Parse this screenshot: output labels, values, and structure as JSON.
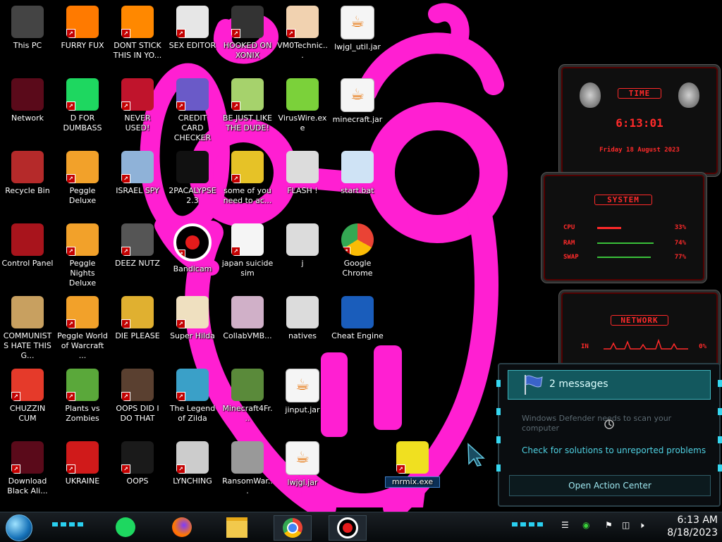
{
  "desktop": {
    "icons": [
      {
        "label": "This PC",
        "icon": "computer-icon",
        "shortcut": false
      },
      {
        "label": "FURRY FUX",
        "icon": "firefox-icon",
        "shortcut": true
      },
      {
        "label": "DONT STICK THIS IN YO...",
        "icon": "vlc-cone-icon",
        "shortcut": true
      },
      {
        "label": "SEX EDITOR",
        "icon": "hex-editor-icon",
        "shortcut": true
      },
      {
        "label": "HOOKED ON XONIX",
        "icon": "xonix-game-icon",
        "shortcut": true
      },
      {
        "label": "VM0Technic...",
        "icon": "doctor-avatar-icon",
        "shortcut": true
      },
      {
        "label": "lwjgl_util.jar",
        "icon": "java-icon",
        "shortcut": false
      },
      {
        "label": "Network",
        "icon": "alienware-network-icon",
        "shortcut": false
      },
      {
        "label": "D FOR DUMBASS",
        "icon": "green-app-icon",
        "shortcut": true
      },
      {
        "label": "NEVER USED!",
        "icon": "devcpp-icon",
        "shortcut": true
      },
      {
        "label": "CREDIT CARD CHECKER",
        "icon": "credit-card-icon",
        "shortcut": true
      },
      {
        "label": "BE JUST LIKE THE DUDE!",
        "icon": "santa-icon",
        "shortcut": true
      },
      {
        "label": "VirusWire.exe",
        "icon": "lime-icon",
        "shortcut": false
      },
      {
        "label": "minecraft.jar",
        "icon": "java-icon",
        "shortcut": false
      },
      {
        "label": "Recycle Bin",
        "icon": "recycle-bin-icon",
        "shortcut": false
      },
      {
        "label": "Peggle Deluxe",
        "icon": "peggle-icon",
        "shortcut": true
      },
      {
        "label": "ISRAEL SPY",
        "icon": "network-spy-icon",
        "shortcut": true
      },
      {
        "label": "2PACALYPSE 2.3",
        "icon": "terminal-icon",
        "shortcut": false
      },
      {
        "label": "some of you need to ac...",
        "icon": "dog-icon",
        "shortcut": true
      },
      {
        "label": "FLASH !",
        "icon": "flash-file-icon",
        "shortcut": false
      },
      {
        "label": "start.bat",
        "icon": "batch-file-icon",
        "shortcut": false
      },
      {
        "label": "Control Panel",
        "icon": "control-panel-icon",
        "shortcut": false
      },
      {
        "label": "Peggle Nights Deluxe",
        "icon": "peggle-icon",
        "shortcut": true
      },
      {
        "label": "DEEZ NUTZ",
        "icon": "windows-stack-icon",
        "shortcut": true
      },
      {
        "label": "Bandicam",
        "icon": "record-icon",
        "shortcut": true
      },
      {
        "label": "japan suicide sim",
        "icon": "document-icon",
        "shortcut": true
      },
      {
        "label": "j",
        "icon": "file-icon",
        "shortcut": false
      },
      {
        "label": "Google Chrome",
        "icon": "chrome-icon",
        "shortcut": true
      },
      {
        "label": "COMMUNISTS HATE THIS G...",
        "icon": "money-bag-icon",
        "shortcut": false
      },
      {
        "label": "Peggle World of Warcraft ...",
        "icon": "peggle-icon",
        "shortcut": true
      },
      {
        "label": "DIE PLEASE",
        "icon": "de-icon",
        "shortcut": true
      },
      {
        "label": "Super Hilda",
        "icon": "pixel-art-icon",
        "shortcut": true
      },
      {
        "label": "CollabVMB...",
        "icon": "collabvm-icon",
        "shortcut": false
      },
      {
        "label": "natives",
        "icon": "file-icon",
        "shortcut": false
      },
      {
        "label": "Cheat Engine",
        "icon": "cheat-engine-icon",
        "shortcut": false
      },
      {
        "label": "CHUZZIN CUM",
        "icon": "chuzzle-icon",
        "shortcut": true
      },
      {
        "label": "Plants vs Zombies",
        "icon": "plants-icon",
        "shortcut": true
      },
      {
        "label": "OOPS DID I DO THAT",
        "icon": "portrait-icon",
        "shortcut": true
      },
      {
        "label": "The Legend of Zilda",
        "icon": "zelda-icon",
        "shortcut": true
      },
      {
        "label": "Minecraft4Fr...",
        "icon": "minecraft-icon",
        "shortcut": false
      },
      {
        "label": "jinput.jar",
        "icon": "java-icon",
        "shortcut": false
      },
      {
        "label": "Download Black Ali...",
        "icon": "alienware-icon",
        "shortcut": true
      },
      {
        "label": "UKRAINE",
        "icon": "radiation-icon",
        "shortcut": true
      },
      {
        "label": "OOPS",
        "icon": "skull-monitor-icon",
        "shortcut": true
      },
      {
        "label": "LYNCHING",
        "icon": "noose-icon",
        "shortcut": true
      },
      {
        "label": "RansomWar...",
        "icon": "skull-icon",
        "shortcut": false
      },
      {
        "label": "lwjgl.jar",
        "icon": "java-icon",
        "shortcut": false
      },
      {
        "label": "mrmix.exe",
        "icon": "yellow-face-icon",
        "shortcut": true
      }
    ]
  },
  "gadgets": {
    "time": {
      "title": "TIME",
      "clock": "6:13:01",
      "date": "Friday 18 August 2023"
    },
    "system": {
      "title": "SYSTEM",
      "rows": [
        {
          "label": "CPU",
          "value": "33%"
        },
        {
          "label": "RAM",
          "value": "74%"
        },
        {
          "label": "SWAP",
          "value": "77%"
        }
      ]
    },
    "network": {
      "title": "NETWORK",
      "in_label": "IN",
      "in_value": "0%"
    }
  },
  "action_center": {
    "header": "2 messages",
    "message1": "Windows Defender needs to scan your computer",
    "message2": "Check for solutions to unreported problems",
    "button": "Open Action Center"
  },
  "taskbar": {
    "apps": [
      "spotify-icon",
      "firefox-icon",
      "file-explorer-icon",
      "chrome-icon",
      "bandicam-icon"
    ],
    "time": "6:13 AM",
    "date": "8/18/2023"
  },
  "colors": {
    "wallpaper_pink": "#ff1fd2",
    "gadget_red": "#ff2a2a",
    "action_center_teal": "#13585e"
  }
}
